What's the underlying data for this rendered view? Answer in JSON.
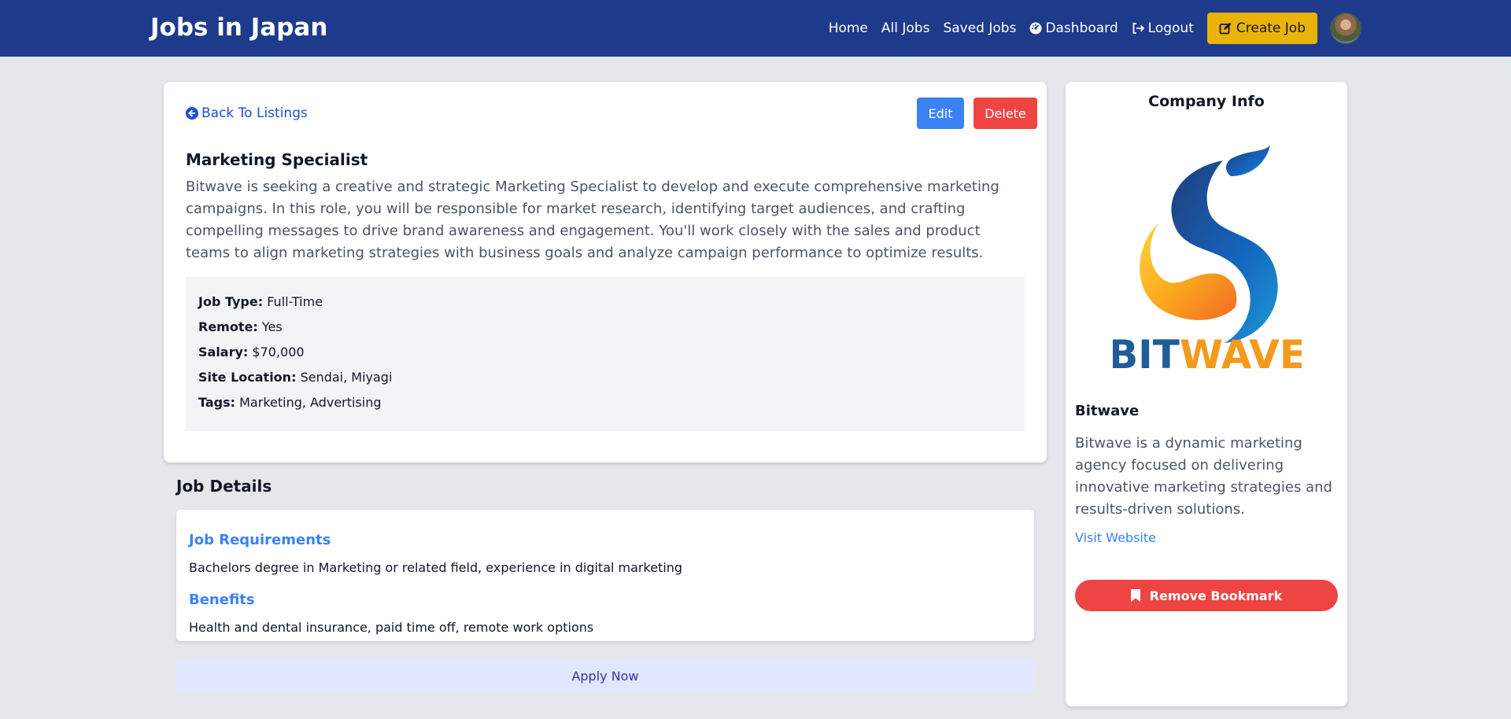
{
  "header": {
    "brand": "Jobs in Japan",
    "nav": {
      "home": "Home",
      "all_jobs": "All Jobs",
      "saved_jobs": "Saved Jobs",
      "dashboard": "Dashboard",
      "logout": "Logout",
      "create_job": "Create Job"
    },
    "icons": [
      "gauge-icon",
      "logout-icon",
      "edit-icon",
      "avatar"
    ]
  },
  "job": {
    "back_label": "Back To Listings",
    "edit_label": "Edit",
    "delete_label": "Delete",
    "title": "Marketing Specialist",
    "description": "Bitwave is seeking a creative and strategic Marketing Specialist to develop and execute comprehensive marketing campaigns. In this role, you will be responsible for market research, identifying target audiences, and crafting compelling messages to drive brand awareness and engagement. You'll work closely with the sales and product teams to align marketing strategies with business goals and analyze campaign performance to optimize results.",
    "info": {
      "job_type_label": "Job Type:",
      "job_type": "Full-Time",
      "remote_label": "Remote:",
      "remote": "Yes",
      "salary_label": "Salary:",
      "salary": "$70,000",
      "site_label": "Site Location:",
      "site": "Sendai, Miyagi",
      "tags_label": "Tags:",
      "tags": "Marketing, Advertising"
    }
  },
  "details": {
    "heading": "Job Details",
    "requirements_heading": "Job Requirements",
    "requirements": "Bachelors degree in Marketing or related field, experience in digital marketing",
    "benefits_heading": "Benefits",
    "benefits": "Health and dental insurance, paid time off, remote work options",
    "apply_label": "Apply Now"
  },
  "company": {
    "heading": "Company Info",
    "logo_text_1": "BIT",
    "logo_text_2": "WAVE",
    "name": "Bitwave",
    "description": "Bitwave is a dynamic marketing agency focused on delivering innovative marketing strategies and results-driven solutions.",
    "visit_label": "Visit Website",
    "bookmark_label": "Remove Bookmark"
  },
  "colors": {
    "header_bg": "#1e3a8a",
    "create_btn": "#eab308",
    "edit_btn": "#3b82f6",
    "delete_btn": "#ef4444",
    "apply_bg": "#e0e7ff",
    "logo_blue": "#1f5c99",
    "logo_orange": "#f39a1e"
  }
}
